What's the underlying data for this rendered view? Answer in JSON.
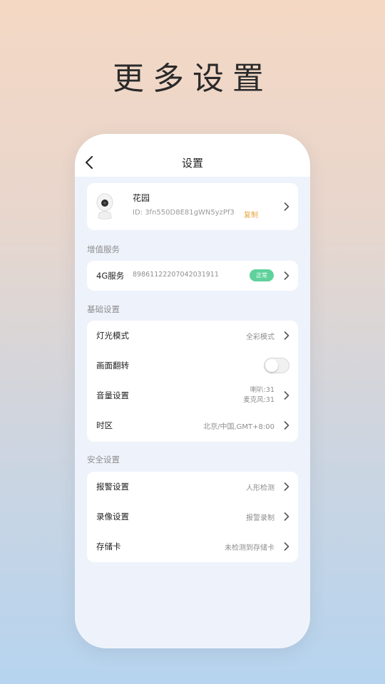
{
  "hero_title": "更多设置",
  "header": {
    "title": "设置"
  },
  "device": {
    "name": "花园",
    "id": "ID: 3fn550D8E81gWN5yzPf3",
    "copy_label": "复制"
  },
  "value_added": {
    "section_label": "增值服务",
    "service_label": "4G服务",
    "sim_number": "89861122207042031911",
    "status": "正常",
    "status_color": "#5fd19b"
  },
  "basic": {
    "section_label": "基础设置",
    "light_mode": {
      "label": "灯光模式",
      "value": "全彩模式"
    },
    "flip": {
      "label": "画面翻转",
      "enabled": false
    },
    "volume": {
      "label": "音量设置",
      "speaker": "喇叭:31",
      "mic": "麦克风:31"
    },
    "timezone": {
      "label": "时区",
      "value": "北京/中国,GMT+8:00"
    }
  },
  "security": {
    "section_label": "安全设置",
    "alarm": {
      "label": "报警设置",
      "value": "人形检测"
    },
    "recording": {
      "label": "录像设置",
      "value": "报警录制"
    },
    "storage": {
      "label": "存储卡",
      "value": "未检测到存储卡"
    }
  },
  "colors": {
    "accent_copy": "#e8a43c",
    "badge_green": "#5fd19b"
  }
}
